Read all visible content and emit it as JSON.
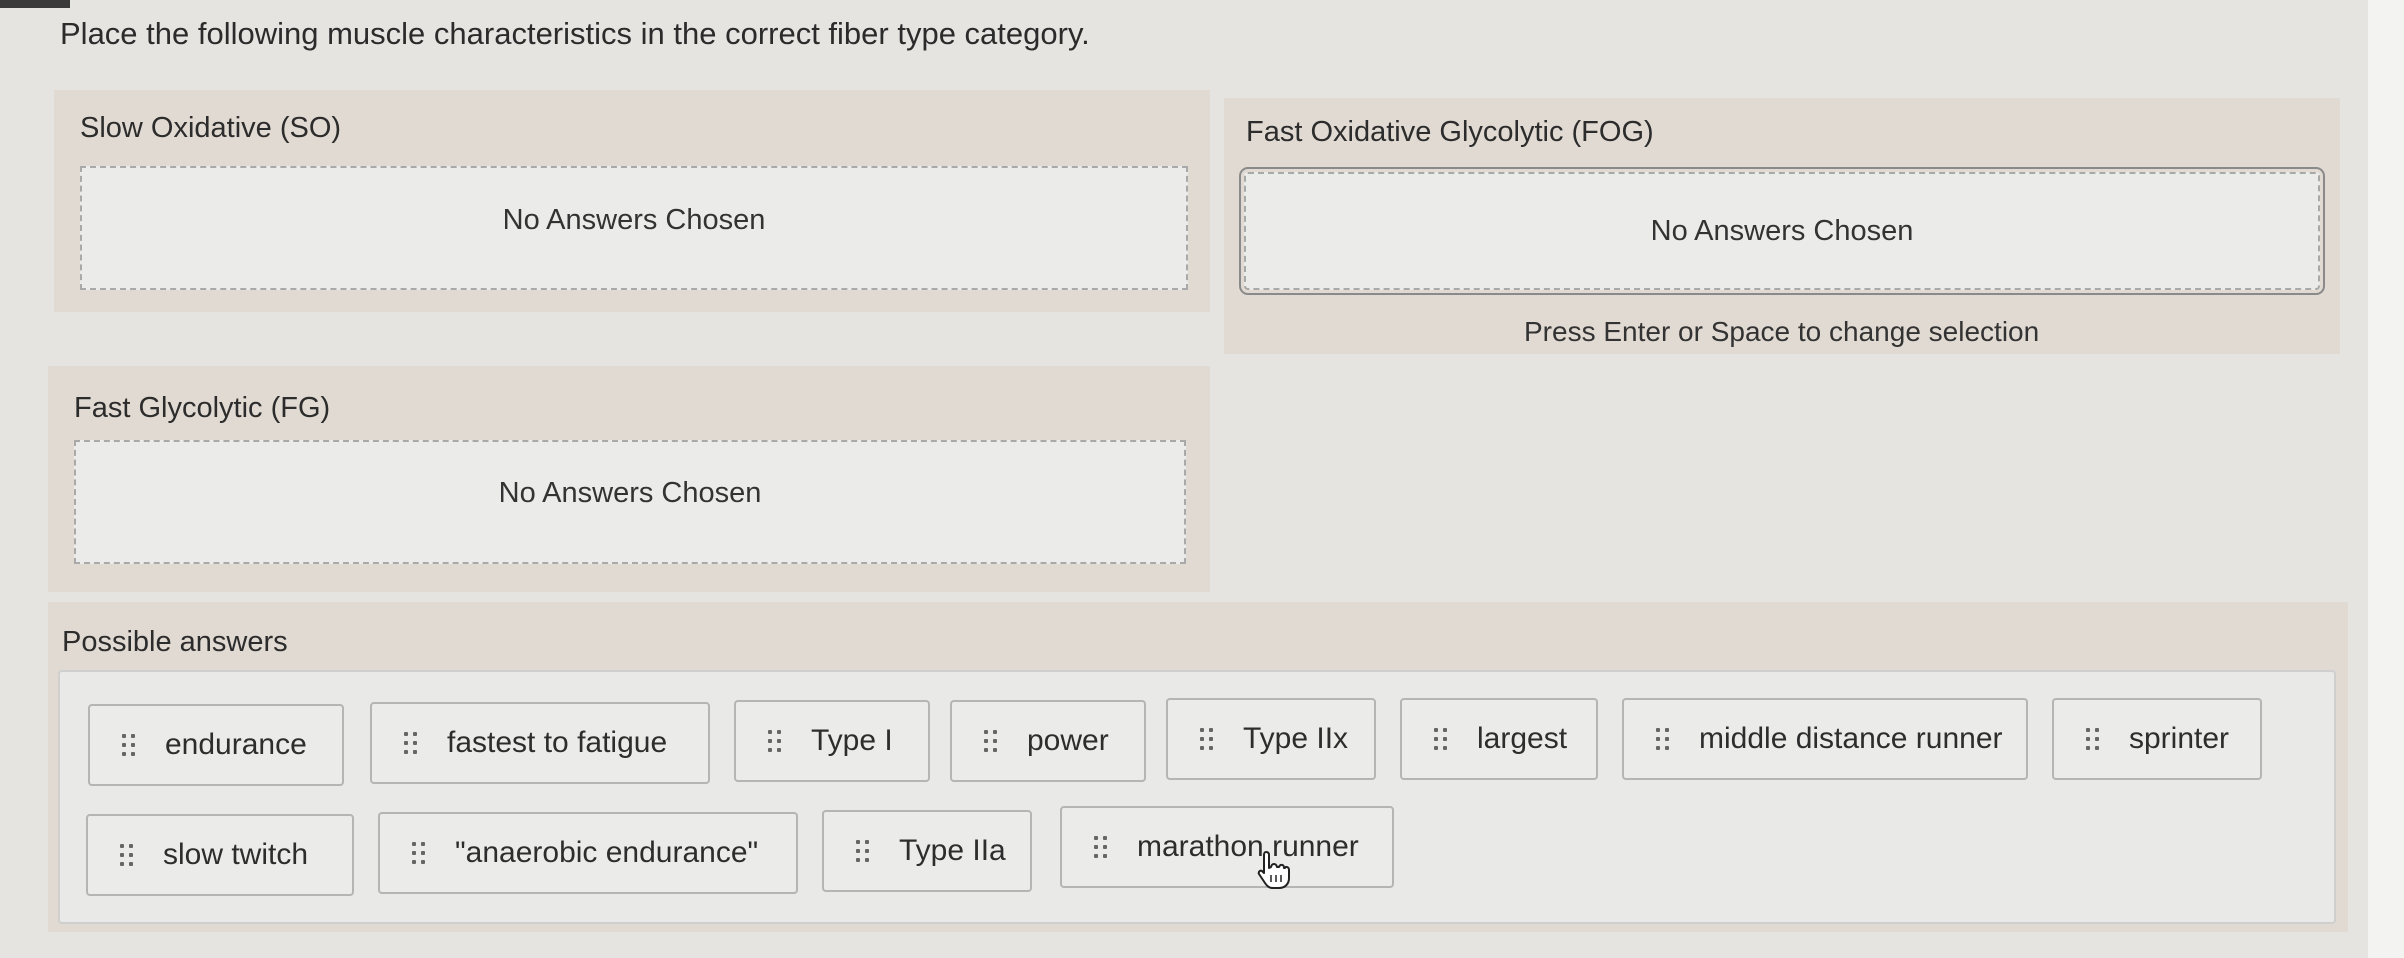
{
  "instruction": "Place the following muscle characteristics in the correct fiber type category.",
  "categories": [
    {
      "title": "Slow Oxidative (SO)",
      "empty_text": "No Answers Chosen"
    },
    {
      "title": "Fast Oxidative Glycolytic (FOG)",
      "empty_text": "No Answers Chosen",
      "hint": "Press Enter or Space to change selection"
    },
    {
      "title": "Fast Glycolytic (FG)",
      "empty_text": "No Answers Chosen"
    }
  ],
  "answers": {
    "title": "Possible answers",
    "items": [
      "endurance",
      "fastest to fatigue",
      "Type I",
      "power",
      "Type IIx",
      "largest",
      "middle distance runner",
      "sprinter",
      "slow twitch",
      "\"anaerobic endurance\"",
      "Type IIa",
      "marathon runner"
    ]
  }
}
